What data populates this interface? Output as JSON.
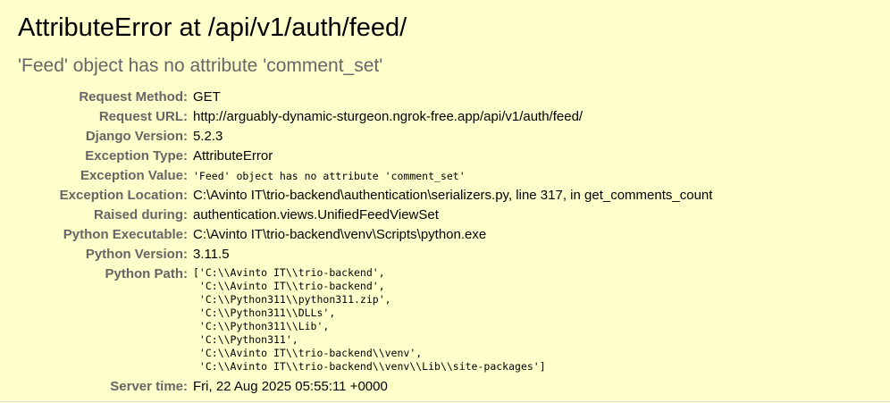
{
  "title": "AttributeError at /api/v1/auth/feed/",
  "exception_message": "'Feed' object has no attribute 'comment_set'",
  "meta": [
    {
      "label": "Request Method:",
      "value": "GET",
      "mono": false
    },
    {
      "label": "Request URL:",
      "value": "http://arguably-dynamic-sturgeon.ngrok-free.app/api/v1/auth/feed/",
      "mono": false
    },
    {
      "label": "Django Version:",
      "value": "5.2.3",
      "mono": false
    },
    {
      "label": "Exception Type:",
      "value": "AttributeError",
      "mono": false
    },
    {
      "label": "Exception Value:",
      "value": "'Feed' object has no attribute 'comment_set'",
      "mono": true
    },
    {
      "label": "Exception Location:",
      "value": "C:\\Avinto IT\\trio-backend\\authentication\\serializers.py, line 317, in get_comments_count",
      "mono": false
    },
    {
      "label": "Raised during:",
      "value": "authentication.views.UnifiedFeedViewSet",
      "mono": false
    },
    {
      "label": "Python Executable:",
      "value": "C:\\Avinto IT\\trio-backend\\venv\\Scripts\\python.exe",
      "mono": false
    },
    {
      "label": "Python Version:",
      "value": "3.11.5",
      "mono": false
    }
  ],
  "python_path": {
    "label": "Python Path:",
    "lines": [
      "['C:\\\\Avinto IT\\\\trio-backend',",
      " 'C:\\\\Avinto IT\\\\trio-backend',",
      " 'C:\\\\Python311\\\\python311.zip',",
      " 'C:\\\\Python311\\\\DLLs',",
      " 'C:\\\\Python311\\\\Lib',",
      " 'C:\\\\Python311',",
      " 'C:\\\\Avinto IT\\\\trio-backend\\\\venv',",
      " 'C:\\\\Avinto IT\\\\trio-backend\\\\venv\\\\Lib\\\\site-packages']"
    ]
  },
  "server_time": {
    "label": "Server time:",
    "value": "Fri, 22 Aug 2025 05:55:11 +0000"
  }
}
